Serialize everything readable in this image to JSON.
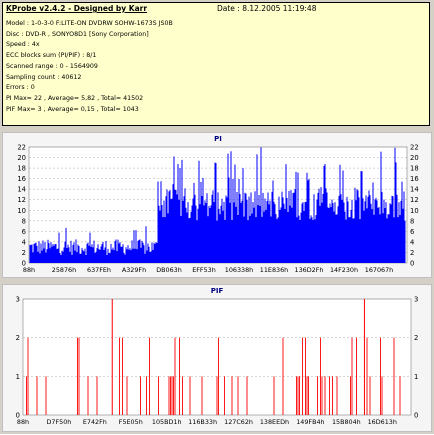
{
  "info": {
    "title": "KProbe v2.4.2 - Designed by Karr",
    "date": "Date : 8.12.2005 11:19:48",
    "lines": [
      "Model : 1-0-3-0 F:LITE-ON DVDRW SOHW-1673S JS0B",
      "Disc : DVD-R , SONYO8D1 [Sony Corporation]",
      "Speed : 4x",
      "ECC blocks sum (PI/PIF) : 8/1",
      "Scanned range : 0 - 1564909",
      "Sampling count : 40612",
      "Errors : 0",
      "PI Max= 22 , Average= 5,82 , Total= 41502",
      "PIF Max= 3 , Average= 0,15 , Total= 1043"
    ]
  },
  "colors": {
    "pi_bars": "#0000ff",
    "pif_bars": "#ff0000",
    "panel_bg": "#f5f5f5",
    "info_bg": "#ffffcc"
  },
  "chart_data": [
    {
      "type": "bar",
      "title": "PI",
      "yticks": [
        0,
        2,
        4,
        6,
        8,
        10,
        12,
        14,
        16,
        18,
        20,
        22
      ],
      "ylim": [
        0,
        22
      ],
      "xticks": [
        "88h",
        "25876h",
        "637FEh",
        "A329Fh",
        "DB063h",
        "EFF53h",
        "106338h",
        "11E836h",
        "136D2Fh",
        "14F230h",
        "167067h"
      ],
      "grid": true,
      "series": [
        {
          "segment": "0 - DB063h",
          "min": 0,
          "typical": 3,
          "max": 8
        },
        {
          "segment": "DB063h - end",
          "min": 6,
          "typical": 11,
          "max": 22
        }
      ]
    },
    {
      "type": "bar",
      "title": "PIF",
      "yticks": [
        0,
        1,
        2,
        3
      ],
      "ylim": [
        0,
        3
      ],
      "xticks": [
        "88h",
        "D7F50h",
        "E742Fh",
        "F5E05h",
        "105BD1h",
        "116B33h",
        "127C62h",
        "138EEDh",
        "149FB4h",
        "15B804h",
        "16D613h"
      ],
      "grid": true,
      "max_value": 3,
      "average": 0.15
    }
  ]
}
